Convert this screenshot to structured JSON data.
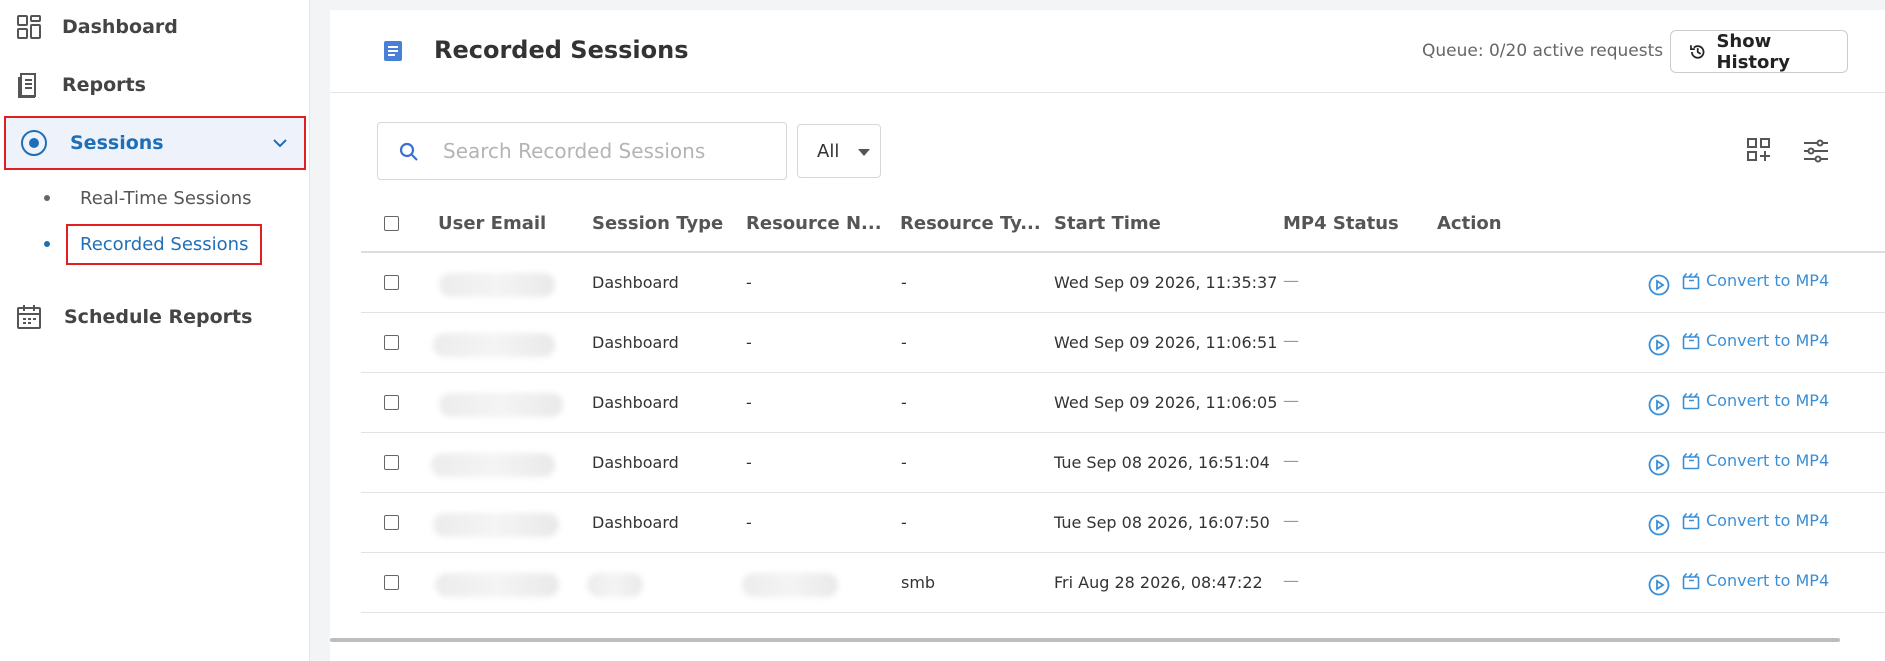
{
  "sidebar": {
    "items": [
      {
        "label": "Dashboard",
        "icon": "dashboard-icon"
      },
      {
        "label": "Reports",
        "icon": "report-icon"
      },
      {
        "label": "Sessions",
        "icon": "sessions-icon"
      },
      {
        "label": "Schedule Reports",
        "icon": "calendar-icon"
      }
    ],
    "sub_items": [
      {
        "label": "Real-Time Sessions"
      },
      {
        "label": "Recorded Sessions"
      }
    ]
  },
  "header": {
    "title": "Recorded Sessions",
    "queue": "Queue: 0/20 active requests",
    "history_label": "Show History"
  },
  "search": {
    "placeholder": "Search Recorded Sessions",
    "value": ""
  },
  "filter": {
    "selected": "All"
  },
  "table": {
    "columns": [
      "User Email",
      "Session Type",
      "Resource N...",
      "Resource Ty...",
      "Start Time",
      "MP4 Status",
      "Action"
    ],
    "convert_label": "Convert to MP4",
    "rows": [
      {
        "session_type": "Dashboard",
        "resource_name": "-",
        "resource_type": "-",
        "start_time": "Wed Sep 09 2026, 11:35:37",
        "mp4_status": "—"
      },
      {
        "session_type": "Dashboard",
        "resource_name": "-",
        "resource_type": "-",
        "start_time": "Wed Sep 09 2026, 11:06:51",
        "mp4_status": "—"
      },
      {
        "session_type": "Dashboard",
        "resource_name": "-",
        "resource_type": "-",
        "start_time": "Wed Sep 09 2026, 11:06:05",
        "mp4_status": "—"
      },
      {
        "session_type": "Dashboard",
        "resource_name": "-",
        "resource_type": "-",
        "start_time": "Tue Sep 08 2026, 16:51:04",
        "mp4_status": "—"
      },
      {
        "session_type": "Dashboard",
        "resource_name": "-",
        "resource_type": "-",
        "start_time": "Tue Sep 08 2026, 16:07:50",
        "mp4_status": "—"
      },
      {
        "session_type": "",
        "resource_name": "",
        "resource_type": "smb",
        "start_time": "Fri Aug 28 2026, 08:47:22",
        "mp4_status": "—"
      }
    ]
  },
  "colors": {
    "accent": "#1f6fb6",
    "link": "#3b8fd6",
    "highlight_border": "#e02020"
  }
}
